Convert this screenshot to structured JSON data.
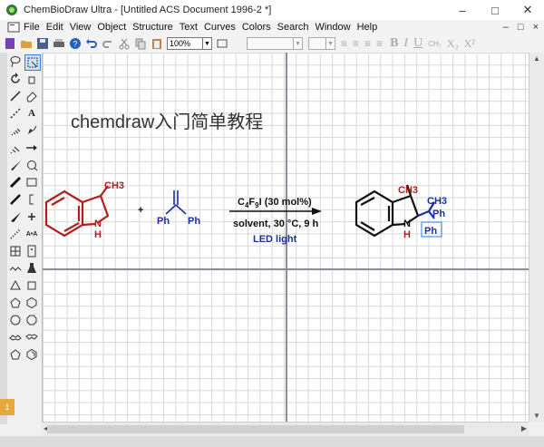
{
  "window": {
    "title": "ChemBioDraw Ultra - [Untitled ACS Document 1996-2 *]",
    "controls": [
      "–",
      "□",
      "✕"
    ]
  },
  "menu": {
    "items": [
      "File",
      "Edit",
      "View",
      "Object",
      "Structure",
      "Text",
      "Curves",
      "Colors",
      "Search",
      "Window",
      "Help"
    ],
    "right": [
      "–",
      "□",
      "×"
    ]
  },
  "toolbar": {
    "zoom": "100%",
    "format_labels": [
      "B",
      "I",
      "U",
      "CH₂",
      "X₂",
      "X²"
    ]
  },
  "canvas": {
    "heading": "chemdraw入门简单教程"
  },
  "scheme": {
    "reactant1": {
      "substituent": "CH3",
      "n": "N",
      "h": "H"
    },
    "plus": "+",
    "reactant2": {
      "left_ph": "Ph",
      "right_ph": "Ph"
    },
    "reagent": {
      "c": "C",
      "sub4": "4",
      "f": "F",
      "sub9": "9",
      "rest": "I (30 mol%)"
    },
    "conditions": "solvent, 30 °C, 9 h",
    "light": "LED light",
    "product": {
      "ch3_ring": "CH3",
      "ch3_side": "CH3",
      "ph_top": "Ph",
      "ph_box": "Ph",
      "n": "N",
      "h": "H"
    }
  },
  "colors": {
    "ring": "#b01e1e",
    "reagent_text": "#111111",
    "led": "#1c2ea6",
    "phenyl": "#1c2ea6",
    "ph_box": "#5aa6e6"
  },
  "taskbar": {
    "badge": "1"
  }
}
